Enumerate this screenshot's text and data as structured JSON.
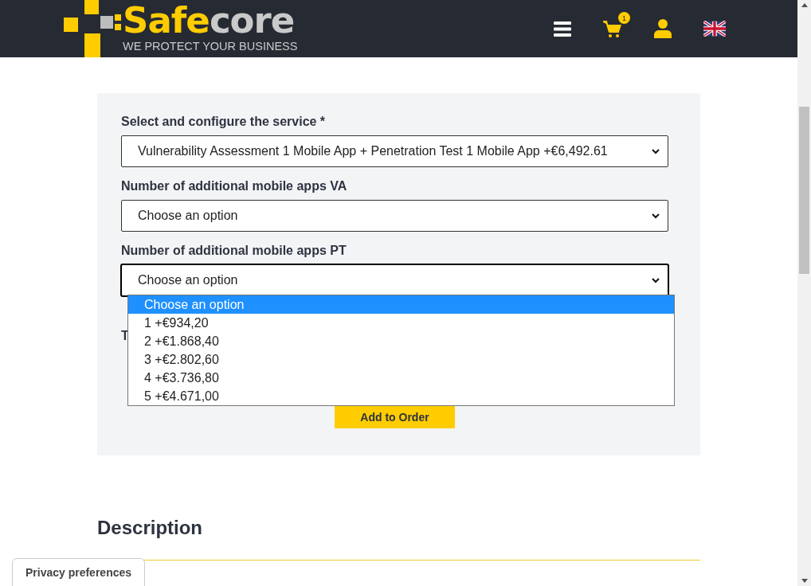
{
  "header": {
    "logo": {
      "name_first": "Safe",
      "name_second": "core",
      "tagline": "WE PROTECT YOUR BUSINESS"
    },
    "cart_count": "1"
  },
  "form": {
    "fields": [
      {
        "label": "Select and configure the service *",
        "value": "Vulnerability Assessment 1 Mobile App + Penetration Test 1 Mobile App +€6,492.61",
        "expanded": false
      },
      {
        "label": "Number of additional mobile apps VA",
        "value": "Choose an option",
        "expanded": false
      },
      {
        "label": "Number of additional mobile apps PT",
        "value": "Choose an option",
        "expanded": true
      }
    ],
    "covered_label": "T",
    "button": "Add to Order"
  },
  "dropdown": {
    "options": [
      {
        "label": "Choose an option",
        "selected": true
      },
      {
        "label": "1 +€934,20",
        "selected": false
      },
      {
        "label": "2 +€1.868,40",
        "selected": false
      },
      {
        "label": "3 +€2.802,60",
        "selected": false
      },
      {
        "label": "4 +€3.736,80",
        "selected": false
      },
      {
        "label": "5 +€4.671,00",
        "selected": false
      }
    ]
  },
  "description": {
    "heading": "Description"
  },
  "privacy_tab": "Privacy preferences"
}
